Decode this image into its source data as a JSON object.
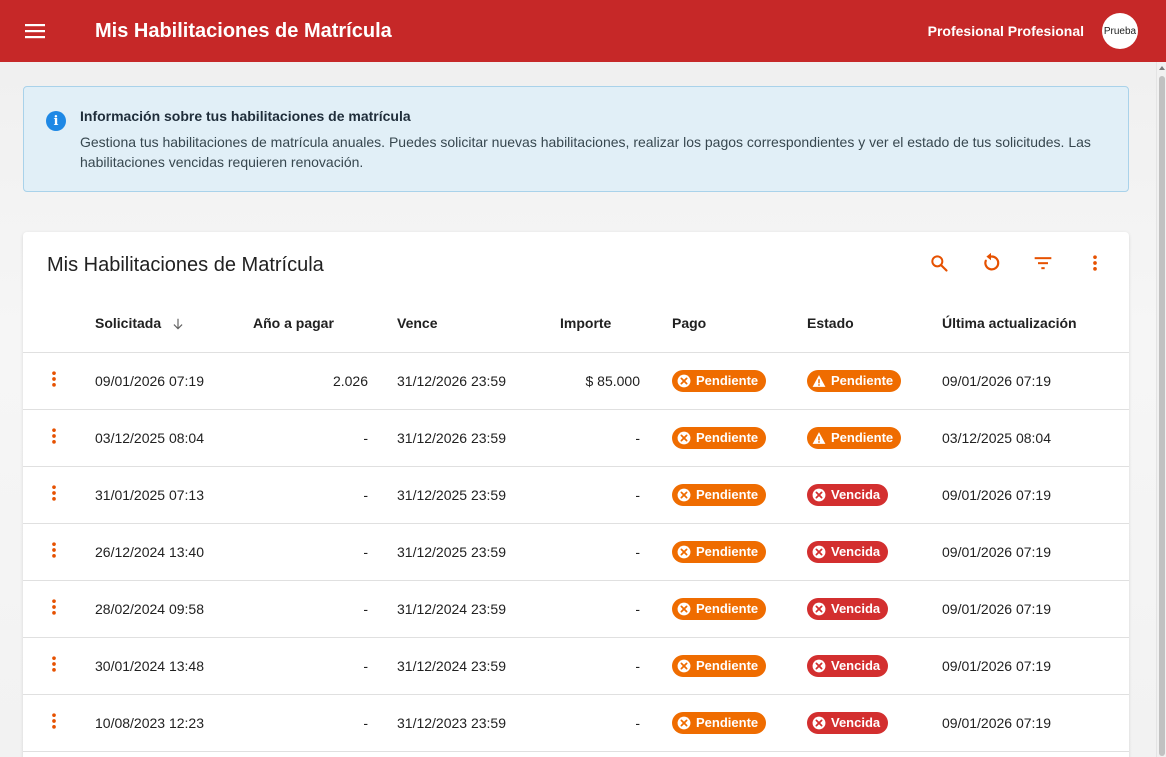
{
  "header": {
    "title": "Mis Habilitaciones de Matrícula",
    "user_name": "Profesional Profesional",
    "avatar_text": "Prueba"
  },
  "info": {
    "title": "Información sobre tus habilitaciones de matrícula",
    "text": "Gestiona tus habilitaciones de matrícula anuales. Puedes solicitar nuevas habilitaciones, realizar los pagos correspondientes y ver el estado de tus solicitudes. Las habilitaciones vencidas requieren renovación."
  },
  "card": {
    "title": "Mis Habilitaciones de Matrícula"
  },
  "table": {
    "headers": {
      "solicitada": "Solicitada",
      "anio": "Año a pagar",
      "vence": "Vence",
      "importe": "Importe",
      "pago": "Pago",
      "estado": "Estado",
      "ultima": "Última actualización"
    },
    "rows": [
      {
        "solicitada": "09/01/2026 07:19",
        "anio": "2.026",
        "vence": "31/12/2026 23:59",
        "importe": "$ 85.000",
        "pago": "Pendiente",
        "estado": "Pendiente",
        "ultima": "09/01/2026 07:19"
      },
      {
        "solicitada": "03/12/2025 08:04",
        "anio": "-",
        "vence": "31/12/2026 23:59",
        "importe": "-",
        "pago": "Pendiente",
        "estado": "Pendiente",
        "ultima": "03/12/2025 08:04"
      },
      {
        "solicitada": "31/01/2025 07:13",
        "anio": "-",
        "vence": "31/12/2025 23:59",
        "importe": "-",
        "pago": "Pendiente",
        "estado": "Vencida",
        "ultima": "09/01/2026 07:19"
      },
      {
        "solicitada": "26/12/2024 13:40",
        "anio": "-",
        "vence": "31/12/2025 23:59",
        "importe": "-",
        "pago": "Pendiente",
        "estado": "Vencida",
        "ultima": "09/01/2026 07:19"
      },
      {
        "solicitada": "28/02/2024 09:58",
        "anio": "-",
        "vence": "31/12/2024 23:59",
        "importe": "-",
        "pago": "Pendiente",
        "estado": "Vencida",
        "ultima": "09/01/2026 07:19"
      },
      {
        "solicitada": "30/01/2024 13:48",
        "anio": "-",
        "vence": "31/12/2024 23:59",
        "importe": "-",
        "pago": "Pendiente",
        "estado": "Vencida",
        "ultima": "09/01/2026 07:19"
      },
      {
        "solicitada": "10/08/2023 12:23",
        "anio": "-",
        "vence": "31/12/2023 23:59",
        "importe": "-",
        "pago": "Pendiente",
        "estado": "Vencida",
        "ultima": "09/01/2026 07:19"
      }
    ]
  },
  "icons": {
    "menu": "menu-icon",
    "search": "search-icon",
    "refresh": "refresh-icon",
    "filter": "filter-icon",
    "more": "more-vert-icon",
    "sort": "arrow-down-icon",
    "info": "info-icon",
    "cancel": "cancel-circle-icon",
    "warning": "warning-triangle-icon"
  },
  "colors": {
    "primary": "#c62828",
    "accent": "#e65100",
    "chip_orange": "#ef6c00",
    "chip_red": "#d32f2f",
    "info_bg": "#e1eff7",
    "info_icon": "#1e88e5"
  }
}
